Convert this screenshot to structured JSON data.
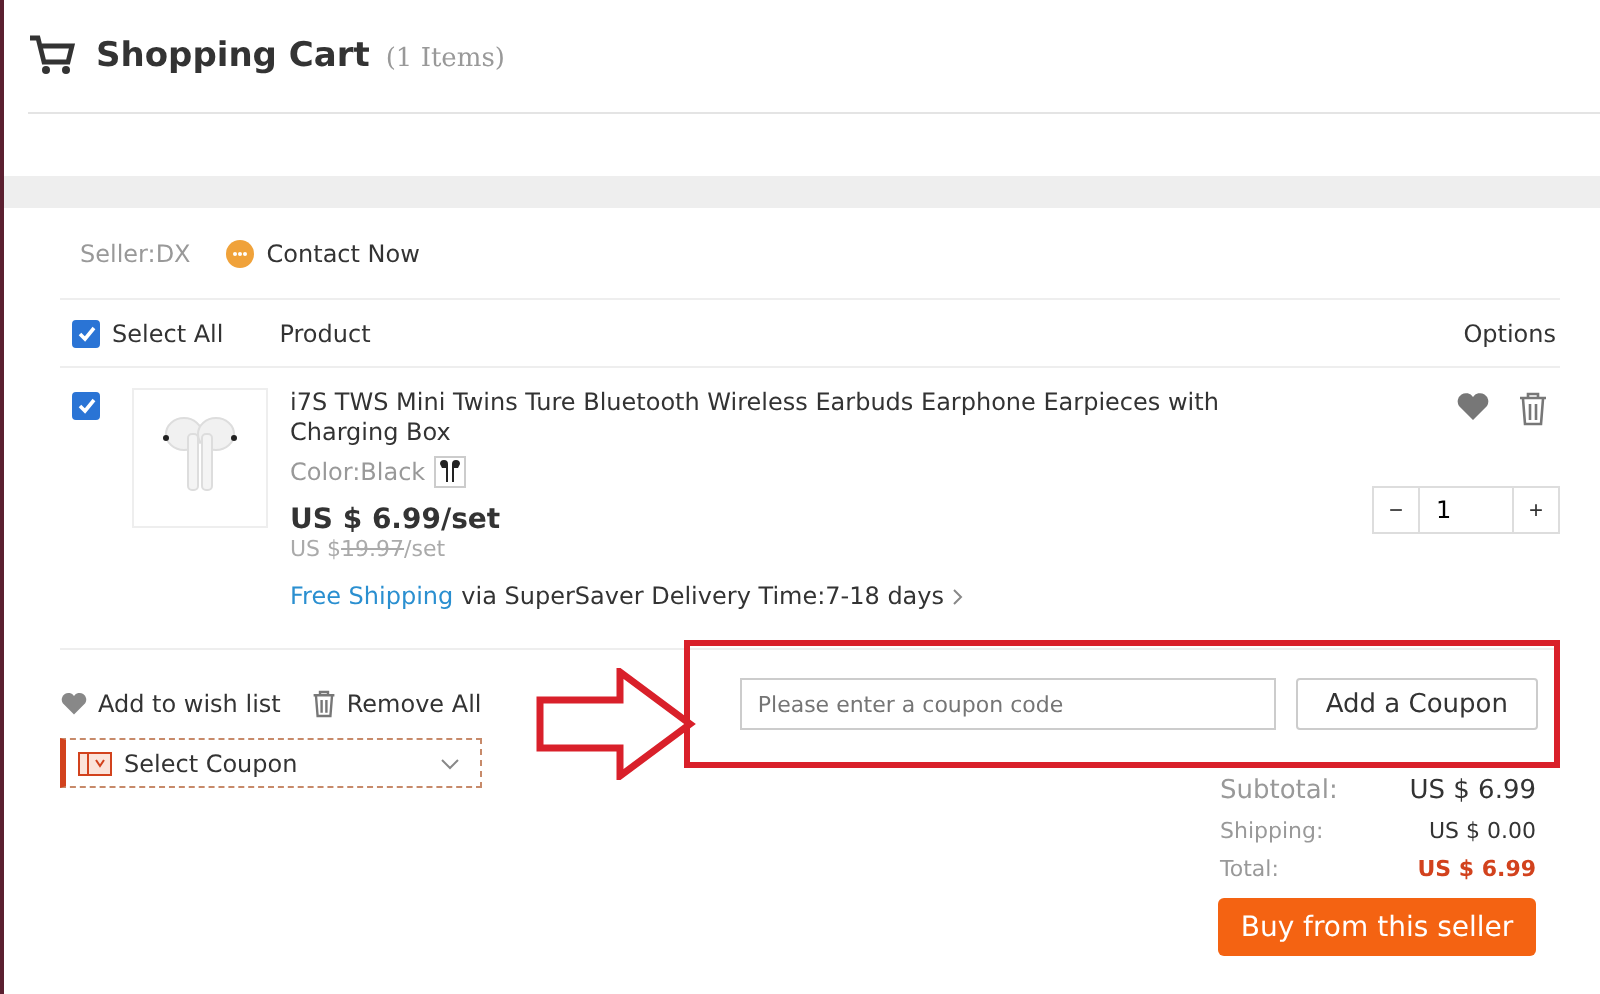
{
  "header": {
    "title": "Shopping Cart",
    "count": "(1 Items)"
  },
  "seller": {
    "label": "Seller:DX",
    "contact": "Contact Now"
  },
  "columns": {
    "select_all": {
      "label": "Select All",
      "checked": true
    },
    "product": "Product",
    "options": "Options"
  },
  "item": {
    "checked": true,
    "title": "i7S TWS Mini Twins Ture Bluetooth Wireless Earbuds Earphone Earpieces with Charging Box",
    "variant": "Color:Black",
    "price": "US $ 6.99/set",
    "old_price": {
      "currency": "US $",
      "amount": "19.97",
      "unit": "/set"
    },
    "shipping_link": "Free Shipping",
    "shipping_text": "via SuperSaver Delivery Time:7-18 days",
    "quantity": "1",
    "minus": "−",
    "plus": "+"
  },
  "actions": {
    "wishlist": "Add to wish list",
    "remove": "Remove All",
    "coupon_select": "Select Coupon"
  },
  "coupon": {
    "placeholder": "Please enter a coupon code",
    "button": "Add a Coupon"
  },
  "totals": [
    {
      "kind": "normal",
      "label": "Subtotal:",
      "value": "US $ 6.99"
    },
    {
      "kind": "small",
      "label": "Shipping:",
      "value": "US $ 0.00"
    },
    {
      "kind": "total",
      "label": "Total:",
      "value": "US $ 6.99"
    }
  ],
  "buy_button": "Buy from this seller"
}
